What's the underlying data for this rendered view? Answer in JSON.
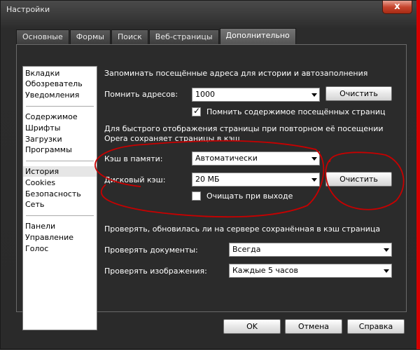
{
  "window": {
    "title": "Настройки",
    "close_label": "x"
  },
  "tabs": [
    {
      "label": "Основные"
    },
    {
      "label": "Формы"
    },
    {
      "label": "Поиск"
    },
    {
      "label": "Веб-страницы"
    },
    {
      "label": "Дополнительно"
    }
  ],
  "sidebar": {
    "items": [
      "Вкладки",
      "Обозреватель",
      "Уведомления",
      "Содержимое",
      "Шрифты",
      "Загрузки",
      "Программы",
      "История",
      "Cookies",
      "Безопасность",
      "Сеть",
      "Панели",
      "Управление",
      "Голос"
    ],
    "selected": "История"
  },
  "history": {
    "heading": "Запоминать посещённые адреса для истории и автозаполнения",
    "remember_label": "Помнить адресов:",
    "remember_value": "1000",
    "clear_label": "Очистить",
    "remember_content_label": "Помнить содержимое посещённых страниц"
  },
  "cache": {
    "note_line1": "Для быстрого отображения страницы при повторном её посещении",
    "note_line2": "Opera сохраняет страницы в кэш",
    "memory_label": "Кэш в памяти:",
    "memory_value": "Автоматически",
    "disk_label": "Дисковый кэш:",
    "disk_value": "20 МБ",
    "clear_label": "Очистить",
    "clear_on_exit_label": "Очищать при выходе"
  },
  "check": {
    "heading": "Проверять, обновилась ли на сервере сохранённая в кэш страница",
    "docs_label": "Проверять документы:",
    "docs_value": "Всегда",
    "images_label": "Проверять изображения:",
    "images_value": "Каждые 5 часов"
  },
  "footer": {
    "ok": "OK",
    "cancel": "Отмена",
    "help": "Справка"
  }
}
